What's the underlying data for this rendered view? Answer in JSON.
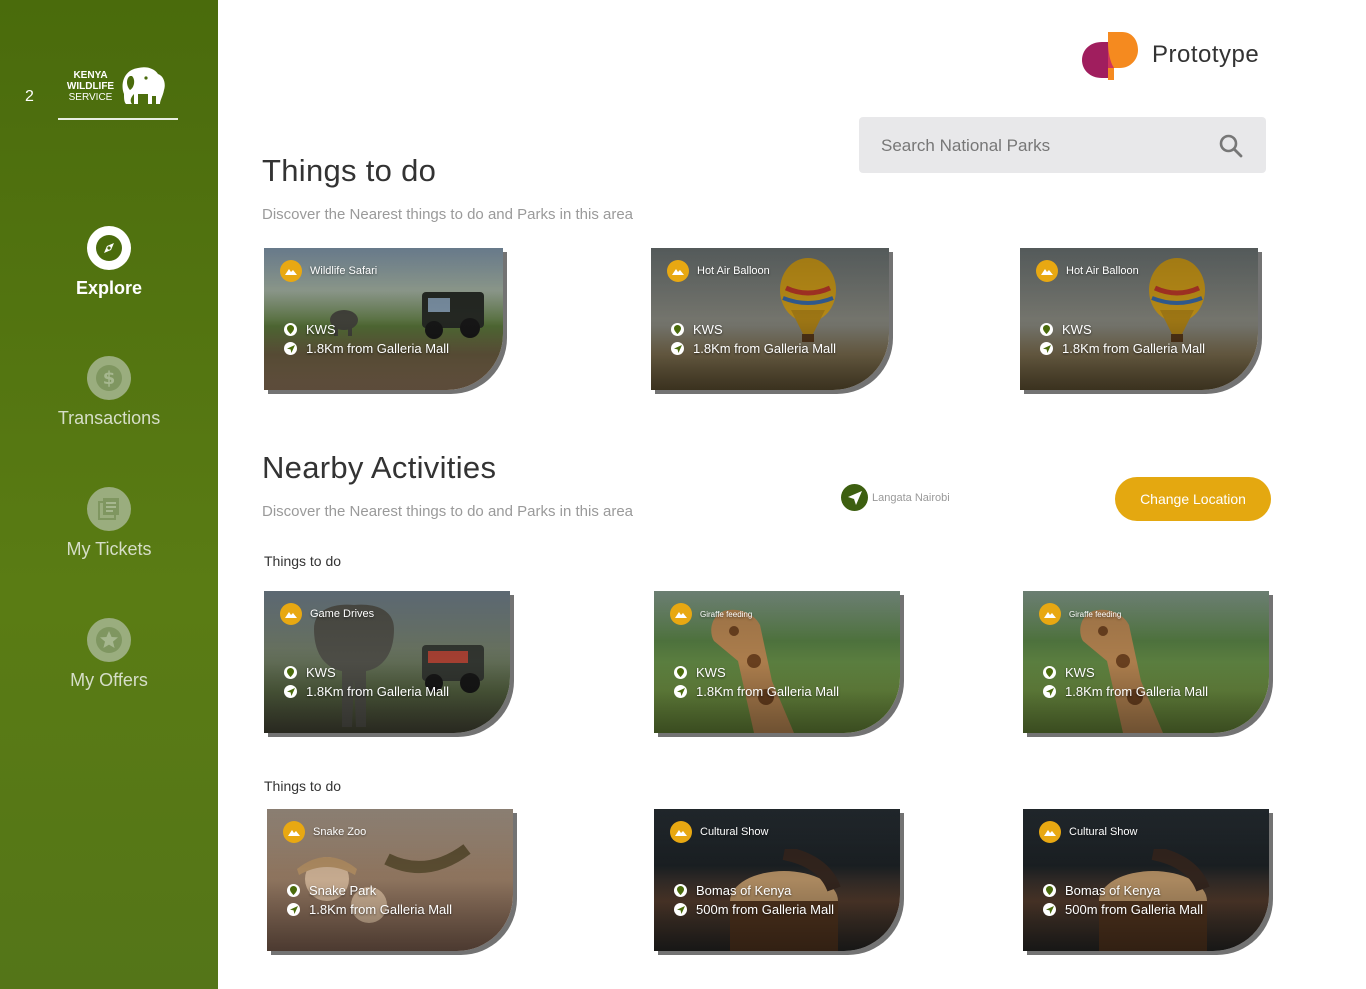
{
  "sidebar": {
    "number": "2",
    "logo": {
      "line1": "KENYA",
      "line2": "WILDLIFE",
      "line3": "SERVICE"
    },
    "nav": [
      {
        "label": "Explore",
        "icon": "compass-icon",
        "active": true
      },
      {
        "label": "Transactions",
        "icon": "dollar-icon",
        "active": false
      },
      {
        "label": "My Tickets",
        "icon": "tickets-icon",
        "active": false
      },
      {
        "label": "My Offers",
        "icon": "star-icon",
        "active": false
      }
    ]
  },
  "brand": {
    "name": "Prototype",
    "colors": {
      "purple": "#a01e5e",
      "orange": "#f58a1f"
    }
  },
  "search": {
    "placeholder": "Search National Parks",
    "icon": "search-icon"
  },
  "section1": {
    "title": "Things to do",
    "subtitle": "Discover the Nearest things to do and Parks in this area",
    "cards": [
      {
        "category": "Wildlife Safari",
        "place": "KWS",
        "distance": "1.8Km from Galleria Mall",
        "theme": "safari"
      },
      {
        "category": "Hot Air Balloon",
        "place": "KWS",
        "distance": "1.8Km from Galleria Mall",
        "theme": "balloon"
      },
      {
        "category": "Hot Air Balloon",
        "place": "KWS",
        "distance": "1.8Km from Galleria Mall",
        "theme": "balloon"
      }
    ]
  },
  "section2": {
    "title": "Nearby Activities",
    "subtitle": "Discover the Nearest things to do and Parks in this area",
    "location": "Langata Nairobi",
    "change_location": "Change Location",
    "group1": {
      "title": "Things to do",
      "cards": [
        {
          "category": "Game Drives",
          "place": "KWS",
          "distance": "1.8Km from Galleria Mall",
          "theme": "elephant"
        },
        {
          "category": "Giraffe feeding",
          "place": "KWS",
          "distance": "1.8Km from Galleria Mall",
          "theme": "giraffe"
        },
        {
          "category": "Giraffe feeding",
          "place": "KWS",
          "distance": "1.8Km from Galleria Mall",
          "theme": "giraffe"
        }
      ]
    },
    "group2": {
      "title": "Things to do",
      "cards": [
        {
          "category": "Snake Zoo",
          "place": "Snake Park",
          "distance": "1.8Km from Galleria Mall",
          "theme": "snake"
        },
        {
          "category": "Cultural Show",
          "place": "Bomas of Kenya",
          "distance": "500m from Galleria Mall",
          "theme": "drum"
        },
        {
          "category": "Cultural Show",
          "place": "Bomas of Kenya",
          "distance": "500m from Galleria Mall",
          "theme": "drum"
        }
      ]
    }
  },
  "colors": {
    "sidebar": "#4a6b0c",
    "accent": "#e4a810",
    "location_icon": "#3d5f10"
  }
}
